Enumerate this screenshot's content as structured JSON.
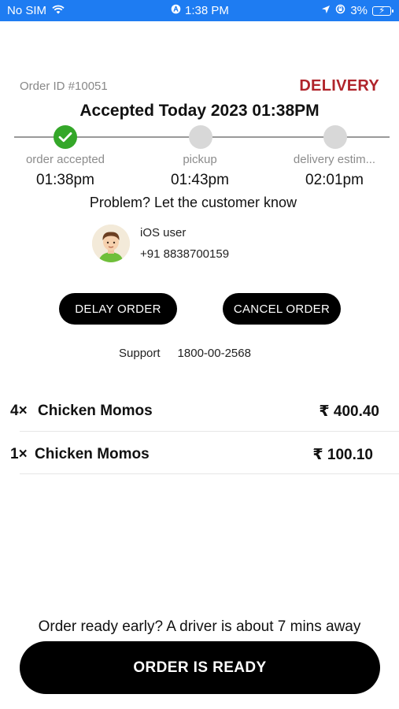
{
  "status_bar": {
    "carrier": "No SIM",
    "time": "1:38 PM",
    "battery": "3%",
    "icons": [
      "wifi-icon",
      "alarm-icon",
      "location-arrow-icon",
      "rotation-lock-icon",
      "battery-charging-icon"
    ],
    "background": "#1e7cf2"
  },
  "order": {
    "id_label": "Order ID #10051",
    "type": "DELIVERY",
    "type_color": "#b0242b",
    "accepted_title": "Accepted Today 2023 01:38PM"
  },
  "progress": {
    "steps": [
      {
        "label": "order accepted",
        "time": "01:38pm",
        "state": "done"
      },
      {
        "label": "pickup",
        "time": "01:43pm",
        "state": "pending"
      },
      {
        "label": "delivery estim...",
        "time": "02:01pm",
        "state": "pending"
      }
    ],
    "done_color": "#34a729"
  },
  "customer": {
    "prompt": "Problem? Let the customer know",
    "name": "iOS user",
    "phone": "+91 8838700159"
  },
  "actions": {
    "delay": "DELAY ORDER",
    "cancel": "CANCEL ORDER"
  },
  "support": {
    "label": "Support",
    "number": "1800-00-2568"
  },
  "items": [
    {
      "qty": "4×",
      "name": "Chicken Momos",
      "price": "₹ 400.40"
    },
    {
      "qty": "1×",
      "name": "Chicken Momos",
      "price": "₹ 100.10"
    }
  ],
  "footer": {
    "note": "Order ready early? A driver is about 7 mins away",
    "ready_button": "ORDER IS READY"
  }
}
